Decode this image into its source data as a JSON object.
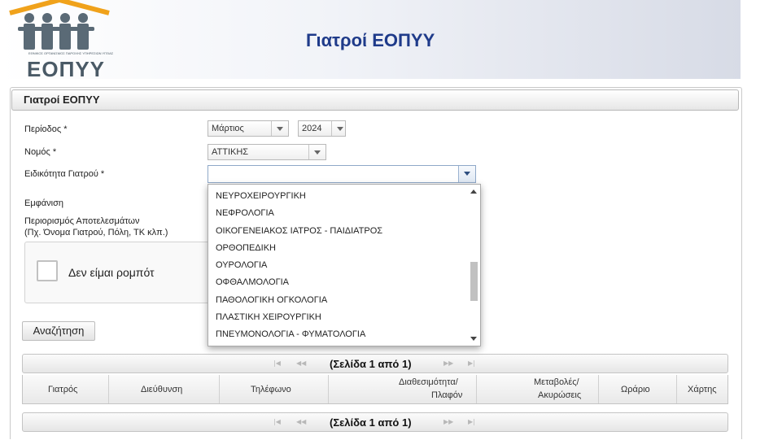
{
  "header": {
    "title": "Γιατροί ΕΟΠΥΥ",
    "logo_text": "ΕΟΠΥΥ",
    "logo_small": "ΕΘΝΙΚΟΣ ΟΡΓΑΝΙΣΜΟΣ ΠΑΡΟΧΗΣ ΥΠΗΡΕΣΙΩΝ ΥΓΕΙΑΣ"
  },
  "panel": {
    "title": "Γιατροί ΕΟΠΥΥ"
  },
  "form": {
    "period_label": "Περίοδος *",
    "month_value": "Μάρτιος",
    "year_value": "2024",
    "prefecture_label": "Νομός *",
    "prefecture_value": "ΑΤΤΙΚΗΣ",
    "specialty_label": "Ειδικότητα Γιατρού *",
    "specialty_value": "",
    "display_label": "Εμφάνιση",
    "restriction_label": "Περιορισμός Αποτελεσμάτων",
    "restriction_hint": "(Πχ. Όνομα Γιατρού, Πόλη, ΤΚ κλπ.)",
    "captcha_text": "Δεν είμαι ρομπότ",
    "search_button": "Αναζήτηση"
  },
  "dropdown": {
    "items": [
      "ΝΕΥΡΟΧΕΙΡΟΥΡΓΙΚΗ",
      "ΝΕΦΡΟΛΟΓΙΑ",
      "ΟΙΚΟΓΕΝΕΙΑΚΟΣ ΙΑΤΡΟΣ - ΠΑΙΔΙΑΤΡΟΣ",
      "ΟΡΘΟΠΕΔΙΚΗ",
      "ΟΥΡΟΛΟΓΙΑ",
      "ΟΦΘΑΛΜΟΛΟΓΙΑ",
      "ΠΑΘΟΛΟΓΙΚΗ ΟΓΚΟΛΟΓΙΑ",
      "ΠΛΑΣΤΙΚΗ ΧΕΙΡΟΥΡΓΙΚΗ",
      "ΠΝΕΥΜΟΝΟΛΟΓΙΑ - ΦΥΜΑΤΟΛΟΓΙΑ"
    ]
  },
  "grid": {
    "pager_text": "(Σελίδα 1 από 1)",
    "pager_text_bottom": "(Σελίδα 1 από 1)",
    "columns": {
      "doctor": "Γιατρός",
      "address": "Διεύθυνση",
      "phone": "Τηλέφωνο",
      "availability_1": "Διαθεσιμότητα/",
      "availability_2": "Πλαφόν",
      "changes_1": "Μεταβολές/",
      "changes_2": "Ακυρώσεις",
      "schedule": "Ωράριο",
      "map": "Χάρτης"
    }
  }
}
